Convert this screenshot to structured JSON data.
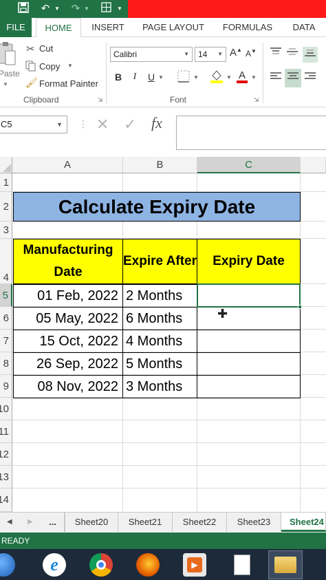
{
  "ribbon": {
    "tabs": [
      "FILE",
      "HOME",
      "INSERT",
      "PAGE LAYOUT",
      "FORMULAS",
      "DATA"
    ],
    "clipboard": {
      "cut": "Cut",
      "copy": "Copy",
      "format_painter": "Format Painter",
      "paste": "Paste",
      "label": "Clipboard"
    },
    "font": {
      "name": "Calibri",
      "size": "14",
      "label": "Font",
      "bold": "B",
      "italic": "I",
      "underline": "U",
      "grow": "A",
      "shrink": "A"
    }
  },
  "formula_bar": {
    "name_box": "C5",
    "fx": "fx",
    "value": ""
  },
  "sheet": {
    "columns": [
      "A",
      "B",
      "C"
    ],
    "rows": [
      "1",
      "2",
      "3",
      "4",
      "5",
      "6",
      "7",
      "8",
      "9",
      "10",
      "11",
      "12",
      "13",
      "14"
    ],
    "title": "Calculate Expiry Date",
    "headers": {
      "manufacturing_date": "Manufacturing Date",
      "expire_after": "Expire After",
      "expiry_date": "Expiry Date"
    },
    "data": [
      {
        "mfg": "01 Feb, 2022",
        "after": "2 Months",
        "expiry": ""
      },
      {
        "mfg": "05 May, 2022",
        "after": "6 Months",
        "expiry": ""
      },
      {
        "mfg": "15 Oct, 2022",
        "after": "4 Months",
        "expiry": ""
      },
      {
        "mfg": "26 Sep, 2022",
        "after": "5 Months",
        "expiry": ""
      },
      {
        "mfg": "08 Nov, 2022",
        "after": "3 Months",
        "expiry": ""
      }
    ]
  },
  "sheet_tabs": {
    "more": "...",
    "tabs": [
      "Sheet20",
      "Sheet21",
      "Sheet22",
      "Sheet23",
      "Sheet24"
    ],
    "active": "Sheet24"
  },
  "status": {
    "text": "READY"
  },
  "colors": {
    "excel_green": "#217346",
    "title_fill": "#8eb4e3",
    "header_fill": "#ffff00"
  }
}
